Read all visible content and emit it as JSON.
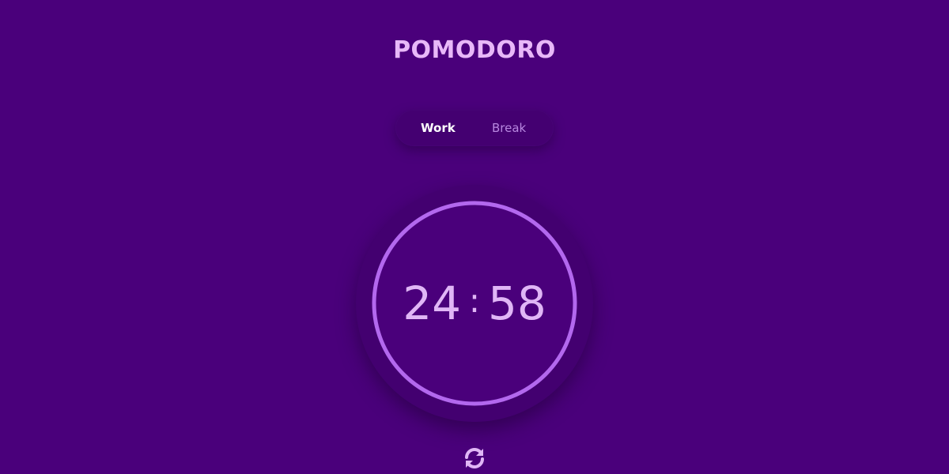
{
  "app": {
    "title": "POMODORO"
  },
  "mode_toggle": {
    "options": [
      {
        "label": "Work",
        "active": true
      },
      {
        "label": "Break",
        "active": false
      }
    ]
  },
  "timer": {
    "minutes": "24",
    "separator": ":",
    "seconds": "58",
    "progress_fraction": 1.0
  },
  "controls": {
    "reset_icon": "refresh-icon"
  },
  "colors": {
    "background": "#4a007b",
    "accent": "#b368ee",
    "text": "#e0b6f6",
    "active_text": "#ffffff",
    "inactive_text": "#b887e0"
  }
}
